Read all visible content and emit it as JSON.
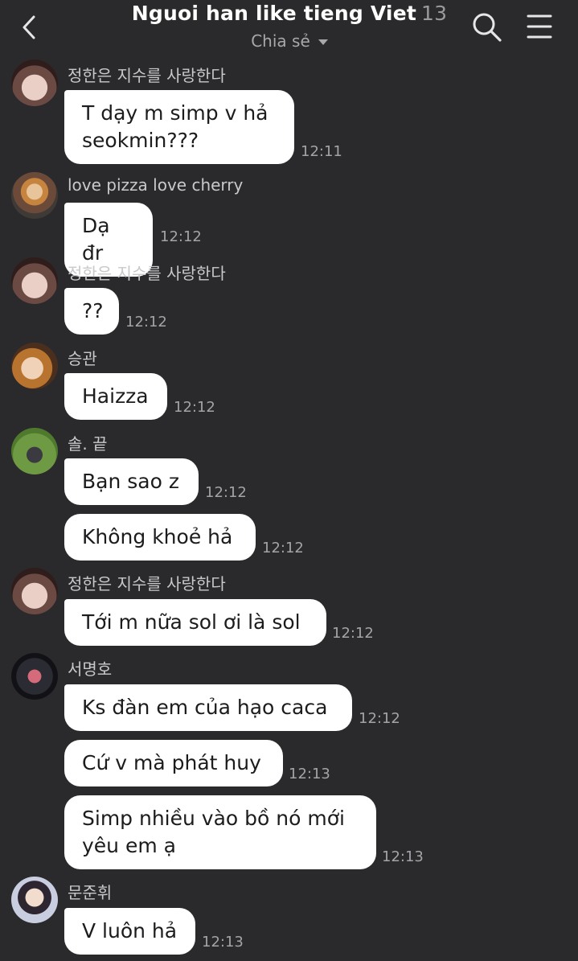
{
  "header": {
    "title": "Nguoi han like tieng Viet",
    "count": "13",
    "subtitle": "Chia sẻ"
  },
  "messages": [
    {
      "sender": "정한은 지수를 사랑한다",
      "avatar": "avatar-jeonghan",
      "text": "T dạy m simp v hả\nseokmin???",
      "time": "12:11"
    },
    {
      "sender": "love pizza love cherry",
      "avatar": "avatar-pizza",
      "text": "Dạ đr",
      "time": "12:12"
    },
    {
      "sender": "정한은 지수를 사랑한다",
      "avatar": "avatar-jeonghan",
      "text": "??",
      "time": "12:12"
    },
    {
      "sender": "승관",
      "avatar": "avatar-seungkwan",
      "text": "Haizza",
      "time": "12:12"
    },
    {
      "sender": "솔. 끝",
      "avatar": "avatar-sol",
      "text": "Bạn sao z",
      "time": "12:12"
    },
    {
      "sender": "",
      "avatar": "",
      "text": "Không khoẻ hả",
      "time": "12:12"
    },
    {
      "sender": "정한은 지수를 사랑한다",
      "avatar": "avatar-jeonghan",
      "text": "Tới m nữa sol ơi là sol",
      "time": "12:12"
    },
    {
      "sender": "서명호",
      "avatar": "avatar-minghao",
      "text": "Ks đàn em của hạo caca",
      "time": "12:12"
    },
    {
      "sender": "",
      "avatar": "",
      "text": "Cứ v mà phát huy",
      "time": "12:13"
    },
    {
      "sender": "",
      "avatar": "",
      "text": "Simp nhiều vào bồ nó mới\nyêu em ạ",
      "time": "12:13"
    },
    {
      "sender": "문준휘",
      "avatar": "avatar-junhui",
      "text": "V luôn hả",
      "time": "12:13"
    }
  ],
  "colors": {
    "background": "#2a2a2c",
    "bubble": "#ffffff",
    "bubble_text": "#1c1c1e",
    "meta_text": "#a4a4a8"
  },
  "icons": {
    "back": "chevron-left-icon",
    "search": "search-icon",
    "menu": "hamburger-menu-icon",
    "dropdown": "caret-down-icon"
  }
}
